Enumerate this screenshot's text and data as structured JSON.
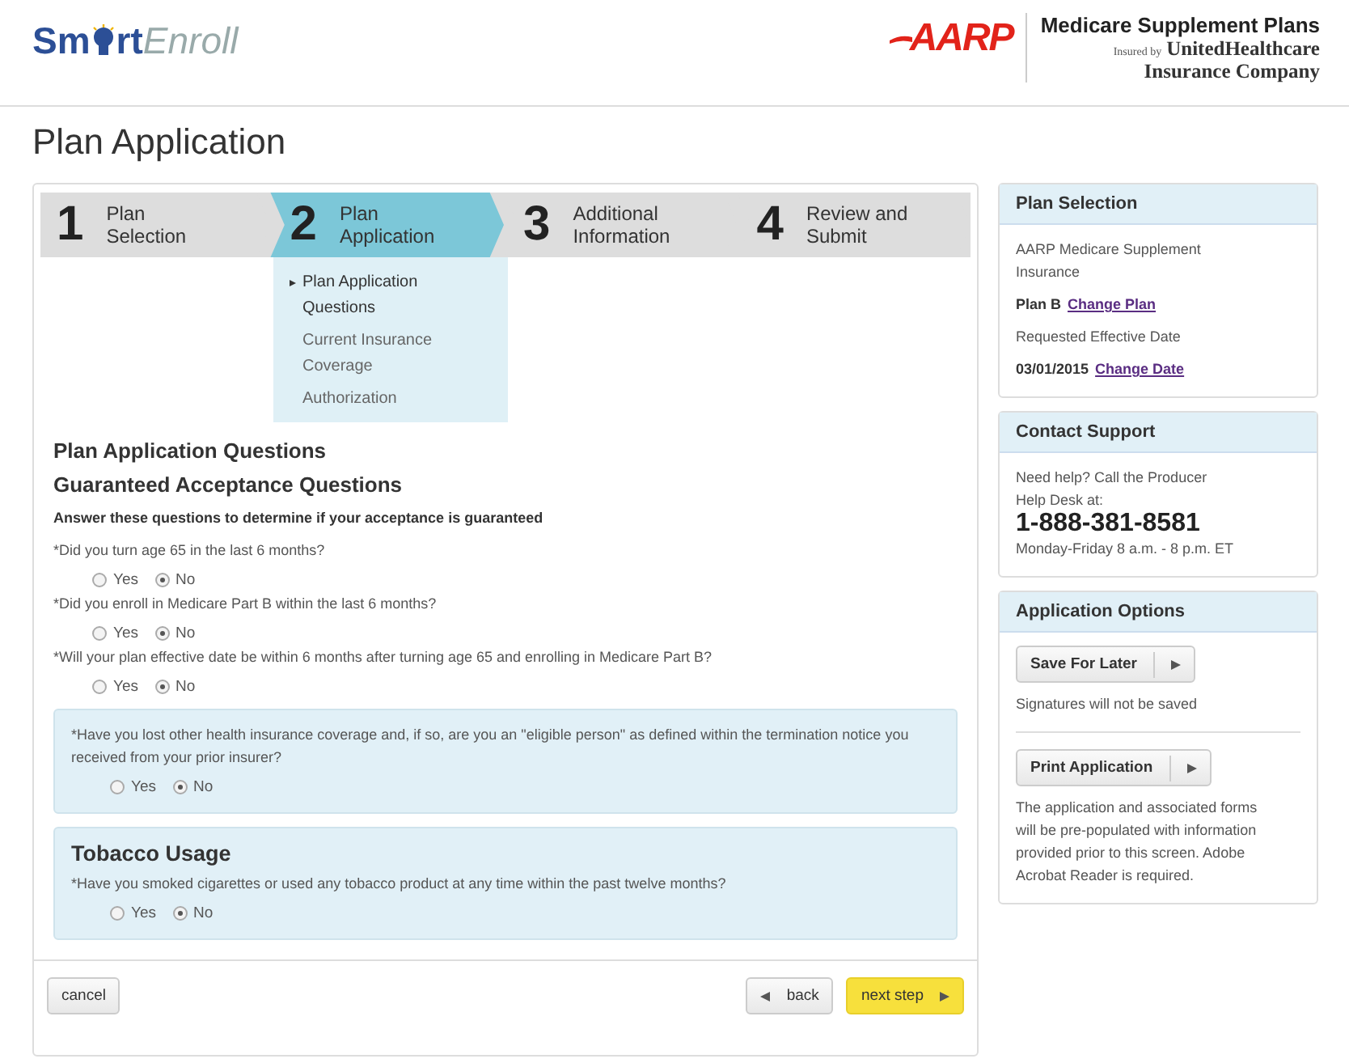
{
  "header": {
    "brand": {
      "start": "Sm",
      "bold_end": "rt",
      "light": "Enroll"
    },
    "partner": {
      "name": "AARP",
      "product": "Medicare Supplement Plans",
      "insured_by": "Insured by",
      "insurer_lines": [
        "UnitedHealthcare",
        "Insurance Company"
      ]
    }
  },
  "page_title": "Plan Application",
  "steps": [
    {
      "number": "1",
      "label_lines": [
        "Plan",
        "Selection"
      ],
      "selected": false
    },
    {
      "number": "2",
      "label_lines": [
        "Plan",
        "Application"
      ],
      "selected": true
    },
    {
      "number": "3",
      "label_lines": [
        "Additional",
        "Information"
      ],
      "selected": false
    },
    {
      "number": "4",
      "label_lines": [
        "Review and",
        "Submit"
      ],
      "selected": false
    }
  ],
  "substeps": [
    {
      "label": "Plan Application Questions",
      "selected": true
    },
    {
      "label": "Current Insurance Coverage",
      "selected": false
    },
    {
      "label": "Authorization",
      "selected": false
    }
  ],
  "form": {
    "heading": "Plan Application Questions",
    "subheading": "Guaranteed Acceptance Questions",
    "instructions": "Answer these questions to determine if your acceptance is guaranteed",
    "questions": [
      {
        "text": "*Did you turn age 65 in the last 6 months?",
        "options": [
          {
            "label": "Yes",
            "selected": false
          },
          {
            "label": "No",
            "selected": true
          }
        ]
      },
      {
        "text": "*Did you enroll in Medicare Part B within the last 6 months?",
        "options": [
          {
            "label": "Yes",
            "selected": false
          },
          {
            "label": "No",
            "selected": true
          }
        ]
      },
      {
        "text": "*Will your plan effective date be within 6 months after turning age 65 and enrolling in Medicare Part B?",
        "options": [
          {
            "label": "Yes",
            "selected": false
          },
          {
            "label": "No",
            "selected": true
          }
        ]
      }
    ],
    "panels": [
      {
        "questions": [
          {
            "text": "*Have you lost other health insurance coverage and, if so, are you an \"eligible person\" as defined within the termination notice you received from your prior insurer?",
            "options": [
              {
                "label": "Yes",
                "selected": false
              },
              {
                "label": "No",
                "selected": true
              }
            ]
          }
        ]
      },
      {
        "title": "Tobacco Usage",
        "questions": [
          {
            "text": "*Have you smoked cigarettes or used any tobacco product at any time within the past twelve months?",
            "options": [
              {
                "label": "Yes",
                "selected": false
              },
              {
                "label": "No",
                "selected": true
              }
            ]
          }
        ]
      }
    ],
    "buttons": {
      "cancel": "cancel",
      "back": "back",
      "next": "next step"
    }
  },
  "sidebar": {
    "plan_selection": {
      "title": "Plan Selection",
      "product": "AARP Medicare Supplement Insurance",
      "plan": "Plan B",
      "change_plan": "Change Plan",
      "date_label": "Requested Effective Date",
      "date": "03/01/2015",
      "change_date": "Change Date"
    },
    "contact": {
      "title": "Contact Support",
      "text": "Need help? Call the Producer Help Desk at:",
      "phone": "1-888-381-8581",
      "hours": "Monday-Friday 8 a.m. - 8 p.m. ET"
    },
    "options": {
      "title": "Application Options",
      "save": "Save For Later",
      "save_note": "Signatures will not be saved",
      "print": "Print Application",
      "print_note": "The application and associated forms will be pre-populated with information provided prior to this screen. Adobe Acrobat Reader is required."
    }
  }
}
